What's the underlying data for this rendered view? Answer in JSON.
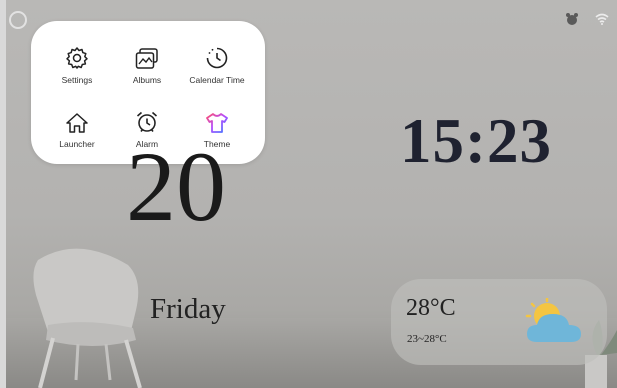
{
  "quick_panel": {
    "items": [
      {
        "label": "Settings",
        "icon": "gear-icon"
      },
      {
        "label": "Albums",
        "icon": "albums-icon"
      },
      {
        "label": "Calendar Time",
        "icon": "clock-icon"
      },
      {
        "label": "Launcher",
        "icon": "home-icon"
      },
      {
        "label": "Alarm",
        "icon": "alarm-icon"
      },
      {
        "label": "Theme",
        "icon": "shirt-icon"
      }
    ]
  },
  "clock": {
    "time": "15:23",
    "day": "20",
    "weekday": "Friday"
  },
  "weather": {
    "temperature": "28°C",
    "range": "23~28°C",
    "icon": "sun-cloud-icon"
  },
  "status_bar": {
    "icons": [
      "alarm-status-icon",
      "wifi-icon"
    ]
  },
  "colors": {
    "panel": "#ffffff",
    "theme_gradient": [
      "#ff4d6d",
      "#ffb020",
      "#3a7bff"
    ],
    "sun": "#f4c542",
    "cloud": "#6fb6d9"
  }
}
